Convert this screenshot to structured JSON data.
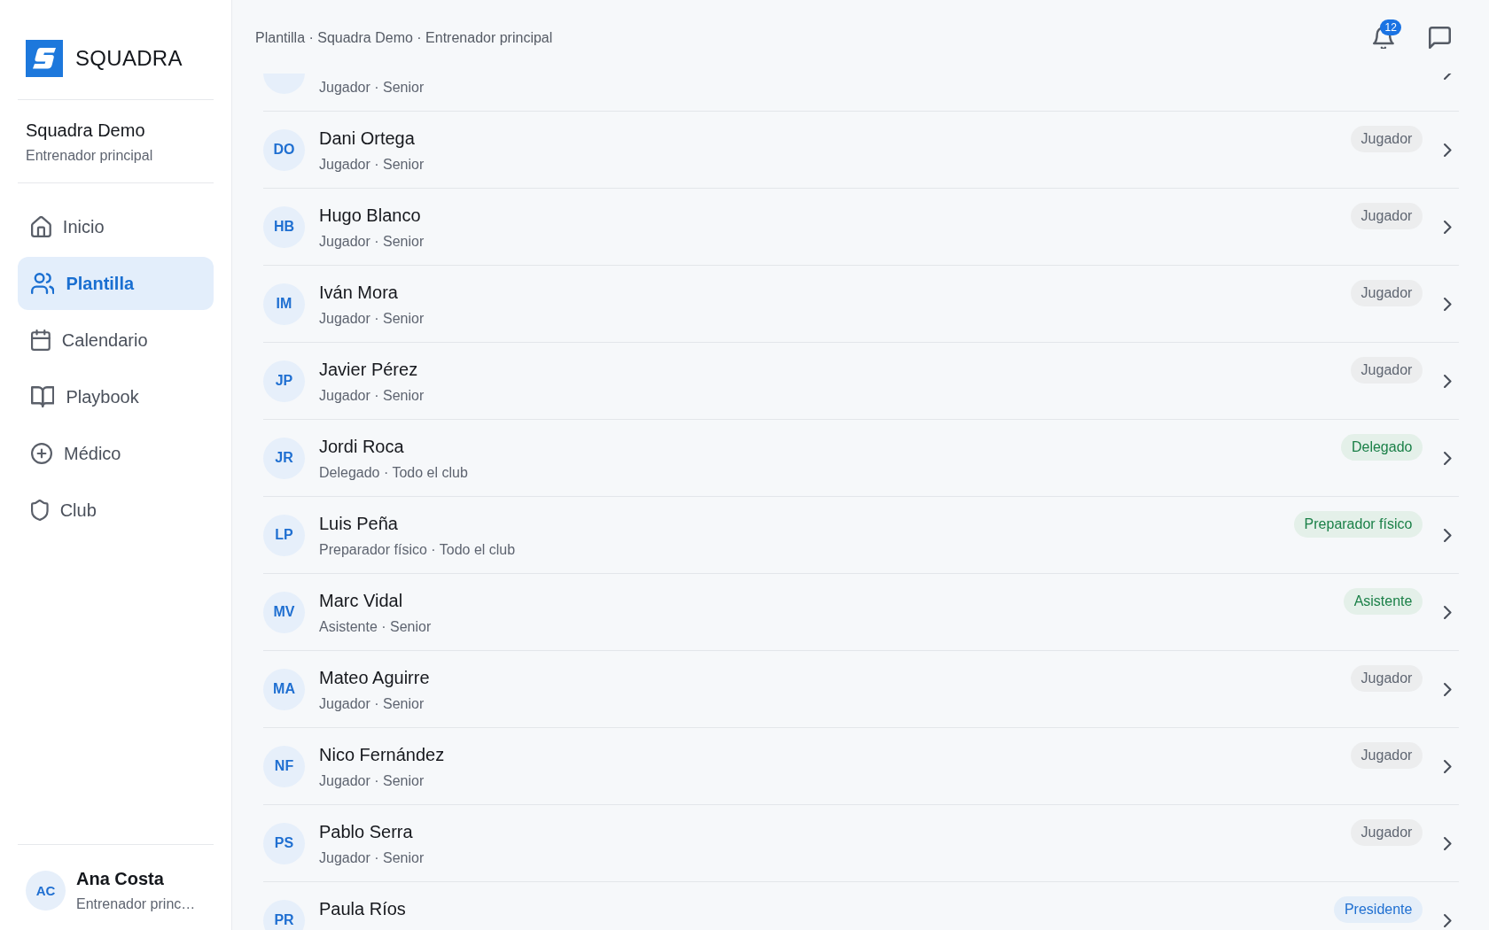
{
  "sidebar": {
    "logo": {
      "text": "SQUADRA"
    },
    "team": {
      "name": "Squadra Demo",
      "role": "Entrenador principal"
    },
    "nav": [
      {
        "label": "Inicio",
        "selected": false
      },
      {
        "label": "Plantilla",
        "selected": true
      },
      {
        "label": "Calendario",
        "selected": false
      },
      {
        "label": "Playbook",
        "selected": false
      },
      {
        "label": "Médico",
        "selected": false
      },
      {
        "label": "Club",
        "selected": false
      }
    ],
    "user": {
      "initials": "AC",
      "name": "Ana Costa",
      "role": "Entrenador princ…"
    }
  },
  "header": {
    "breadcrumb": "Plantilla · Squadra Demo · Entrenador principal",
    "notifications": {
      "count": "12"
    }
  },
  "roster": [
    {
      "subtitle": "Jugador · Senior"
    },
    {
      "initials": "DO",
      "name": "Dani Ortega",
      "subtitle": "Jugador · Senior",
      "badge": {
        "text": "Jugador",
        "color": "#5f6672"
      }
    },
    {
      "initials": "HB",
      "name": "Hugo Blanco",
      "subtitle": "Jugador · Senior",
      "badge": {
        "text": "Jugador",
        "color": "#5f6672"
      }
    },
    {
      "initials": "IM",
      "name": "Iván Mora",
      "subtitle": "Jugador · Senior",
      "badge": {
        "text": "Jugador",
        "color": "#5f6672"
      }
    },
    {
      "initials": "JP",
      "name": "Javier Pérez",
      "subtitle": "Jugador · Senior",
      "badge": {
        "text": "Jugador",
        "color": "#5f6672"
      }
    },
    {
      "initials": "JR",
      "name": "Jordi Roca",
      "subtitle": "Delegado · Todo el club",
      "badge": {
        "text": "Delegado",
        "color": "#1b8048"
      }
    },
    {
      "initials": "LP",
      "name": "Luis Peña",
      "subtitle": "Preparador físico · Todo el club",
      "badge": {
        "text": "Preparador físico",
        "color": "#1b8048"
      }
    },
    {
      "initials": "MV",
      "name": "Marc Vidal",
      "subtitle": "Asistente · Senior",
      "badge": {
        "text": "Asistente",
        "color": "#1b8048"
      }
    },
    {
      "initials": "MA",
      "name": "Mateo Aguirre",
      "subtitle": "Jugador · Senior",
      "badge": {
        "text": "Jugador",
        "color": "#5f6672"
      }
    },
    {
      "initials": "NF",
      "name": "Nico Fernández",
      "subtitle": "Jugador · Senior",
      "badge": {
        "text": "Jugador",
        "color": "#5f6672"
      }
    },
    {
      "initials": "PS",
      "name": "Pablo Serra",
      "subtitle": "Jugador · Senior",
      "badge": {
        "text": "Jugador",
        "color": "#5f6672"
      }
    },
    {
      "initials": "PR",
      "name": "Paula Ríos",
      "badge": {
        "text": "Presidente",
        "color": "#1f6fd1"
      }
    }
  ]
}
